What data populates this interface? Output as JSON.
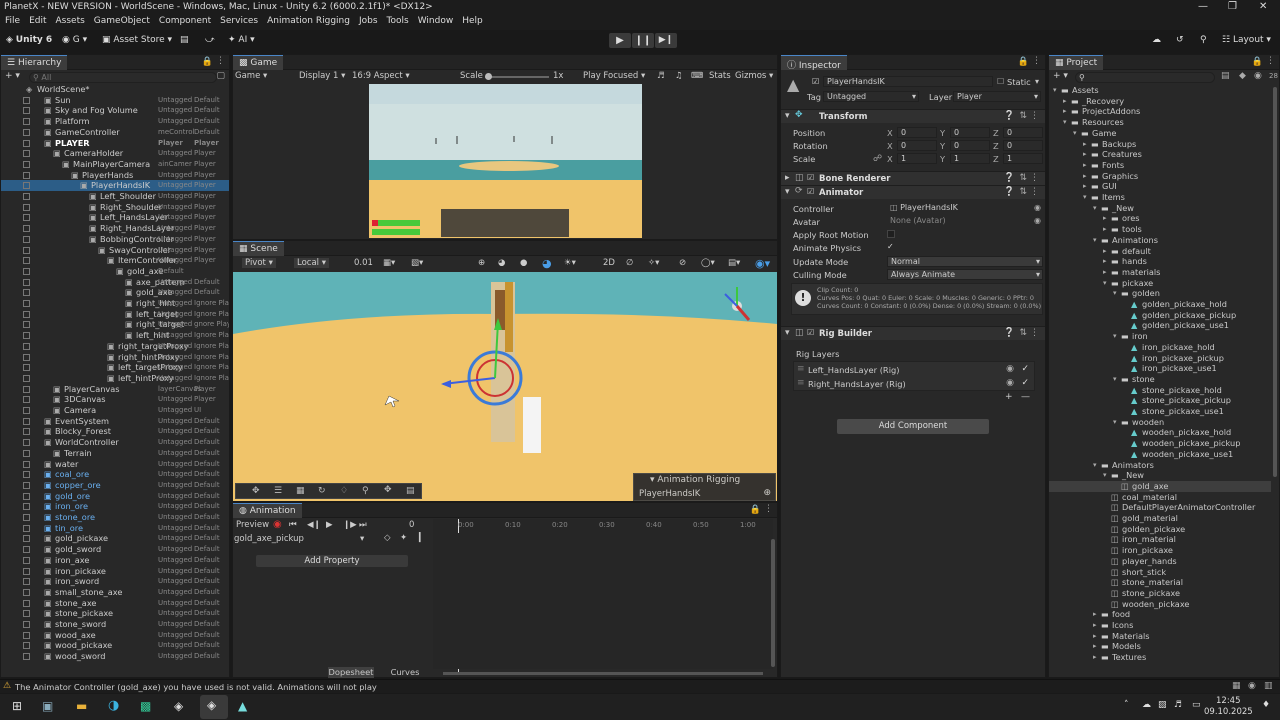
{
  "window": {
    "title": "PlanetX - NEW VERSION - WorldScene - Windows, Mac, Linux - Unity 6.2 (6000.2.1f1)* <DX12>"
  },
  "menu": [
    "File",
    "Edit",
    "Assets",
    "GameObject",
    "Component",
    "Services",
    "Animation Rigging",
    "Jobs",
    "Tools",
    "Window",
    "Help"
  ],
  "toolbar": {
    "unity": "Unity 6",
    "account": "G",
    "asset_store": "Asset Store",
    "ai": "AI",
    "layout": "Layout"
  },
  "hierarchy": {
    "tab": "Hierarchy",
    "search_placeholder": "All",
    "rows": [
      {
        "name": "WorldScene*",
        "indent": 0,
        "tag": "",
        "layer": "",
        "scene": true
      },
      {
        "name": "Sun",
        "indent": 2,
        "tag": "Untagged",
        "layer": "Default"
      },
      {
        "name": "Sky and Fog Volume",
        "indent": 2,
        "tag": "Untagged",
        "layer": "Default"
      },
      {
        "name": "Platform",
        "indent": 2,
        "tag": "Untagged",
        "layer": "Default"
      },
      {
        "name": "GameController",
        "indent": 2,
        "tag": "meControl",
        "layer": "Default"
      },
      {
        "name": "PLAYER",
        "indent": 2,
        "tag": "Player",
        "layer": "Player",
        "bold": true
      },
      {
        "name": "CameraHolder",
        "indent": 3,
        "tag": "Untagged",
        "layer": "Player"
      },
      {
        "name": "MainPlayerCamera",
        "indent": 4,
        "tag": "ainCamer",
        "layer": "Player"
      },
      {
        "name": "PlayerHands",
        "indent": 5,
        "tag": "Untagged",
        "layer": "Player"
      },
      {
        "name": "PlayerHandsIK",
        "indent": 6,
        "tag": "Untagged",
        "layer": "Player",
        "sel": true
      },
      {
        "name": "Left_Shoulder",
        "indent": 7,
        "tag": "Untagged",
        "layer": "Player"
      },
      {
        "name": "Right_Shoulder",
        "indent": 7,
        "tag": "Untagged",
        "layer": "Player"
      },
      {
        "name": "Left_HandsLayer",
        "indent": 7,
        "tag": "Untagged",
        "layer": "Player"
      },
      {
        "name": "Right_HandsLayer",
        "indent": 7,
        "tag": "Untagged",
        "layer": "Player"
      },
      {
        "name": "BobbingController",
        "indent": 7,
        "tag": "Untagged",
        "layer": "Player"
      },
      {
        "name": "SwayController",
        "indent": 8,
        "tag": "Untagged",
        "layer": "Player"
      },
      {
        "name": "ItemController",
        "indent": 9,
        "tag": "Untagged",
        "layer": "Player"
      },
      {
        "name": "gold_axe",
        "indent": 10,
        "tag": "Default",
        "layer": ""
      },
      {
        "name": "axe_pattern",
        "indent": 11,
        "tag": "Untagged",
        "layer": "Default"
      },
      {
        "name": "gold_axe",
        "indent": 11,
        "tag": "Untagged",
        "layer": "Default"
      },
      {
        "name": "right_hint",
        "indent": 11,
        "tag": "Untagged",
        "layer": "Ignore Playe"
      },
      {
        "name": "left_target",
        "indent": 11,
        "tag": "Untagged",
        "layer": "Ignore Playe"
      },
      {
        "name": "right_target",
        "indent": 11,
        "tag": "Untagged",
        "layer": "gnore Playe"
      },
      {
        "name": "left_hint",
        "indent": 11,
        "tag": "Untagged",
        "layer": "Ignore Playe"
      },
      {
        "name": "right_targetProxy",
        "indent": 9,
        "tag": "Untagged",
        "layer": "Ignore Playe"
      },
      {
        "name": "right_hintProxy",
        "indent": 9,
        "tag": "Untagged",
        "layer": "Ignore Playe"
      },
      {
        "name": "left_targetProxy",
        "indent": 9,
        "tag": "Untagged",
        "layer": "Ignore Playe"
      },
      {
        "name": "left_hintProxy",
        "indent": 9,
        "tag": "Untagged",
        "layer": "Ignore Playe"
      },
      {
        "name": "PlayerCanvas",
        "indent": 3,
        "tag": "layerCanvas",
        "layer": "Player"
      },
      {
        "name": "3DCanvas",
        "indent": 3,
        "tag": "Untagged",
        "layer": "Player"
      },
      {
        "name": "Camera",
        "indent": 3,
        "tag": "Untagged",
        "layer": "UI"
      },
      {
        "name": "EventSystem",
        "indent": 2,
        "tag": "Untagged",
        "layer": "Default"
      },
      {
        "name": "Blocky_Forest",
        "indent": 2,
        "tag": "Untagged",
        "layer": "Default"
      },
      {
        "name": "WorldController",
        "indent": 2,
        "tag": "Untagged",
        "layer": "Default"
      },
      {
        "name": "Terrain",
        "indent": 3,
        "tag": "Untagged",
        "layer": "Default"
      },
      {
        "name": "water",
        "indent": 2,
        "tag": "Untagged",
        "layer": "Default"
      },
      {
        "name": "coal_ore",
        "indent": 2,
        "tag": "Untagged",
        "layer": "Default",
        "blue": true
      },
      {
        "name": "copper_ore",
        "indent": 2,
        "tag": "Untagged",
        "layer": "Default",
        "blue": true
      },
      {
        "name": "gold_ore",
        "indent": 2,
        "tag": "Untagged",
        "layer": "Default",
        "blue": true
      },
      {
        "name": "iron_ore",
        "indent": 2,
        "tag": "Untagged",
        "layer": "Default",
        "blue": true
      },
      {
        "name": "stone_ore",
        "indent": 2,
        "tag": "Untagged",
        "layer": "Default",
        "blue": true
      },
      {
        "name": "tin_ore",
        "indent": 2,
        "tag": "Untagged",
        "layer": "Default",
        "blue": true
      },
      {
        "name": "gold_pickaxe",
        "indent": 2,
        "tag": "Untagged",
        "layer": "Default"
      },
      {
        "name": "gold_sword",
        "indent": 2,
        "tag": "Untagged",
        "layer": "Default"
      },
      {
        "name": "iron_axe",
        "indent": 2,
        "tag": "Untagged",
        "layer": "Default"
      },
      {
        "name": "iron_pickaxe",
        "indent": 2,
        "tag": "Untagged",
        "layer": "Default"
      },
      {
        "name": "iron_sword",
        "indent": 2,
        "tag": "Untagged",
        "layer": "Default"
      },
      {
        "name": "small_stone_axe",
        "indent": 2,
        "tag": "Untagged",
        "layer": "Default"
      },
      {
        "name": "stone_axe",
        "indent": 2,
        "tag": "Untagged",
        "layer": "Default"
      },
      {
        "name": "stone_pickaxe",
        "indent": 2,
        "tag": "Untagged",
        "layer": "Default"
      },
      {
        "name": "stone_sword",
        "indent": 2,
        "tag": "Untagged",
        "layer": "Default"
      },
      {
        "name": "wood_axe",
        "indent": 2,
        "tag": "Untagged",
        "layer": "Default"
      },
      {
        "name": "wood_pickaxe",
        "indent": 2,
        "tag": "Untagged",
        "layer": "Default"
      },
      {
        "name": "wood_sword",
        "indent": 2,
        "tag": "Untagged",
        "layer": "Default"
      }
    ]
  },
  "game": {
    "tab": "Game",
    "mode": "Game",
    "display": "Display 1",
    "aspect": "16:9 Aspect",
    "scale_label": "Scale",
    "scale_value": "1x",
    "play_focused": "Play Focused",
    "stats": "Stats",
    "gizmos": "Gizmos"
  },
  "scene": {
    "tab": "Scene",
    "pivot": "Pivot",
    "local": "Local",
    "snap": "0.01",
    "overlay_title": "Animation Rigging",
    "overlay_item": "PlayerHandsIK"
  },
  "animation": {
    "tab": "Animation",
    "preview": "Preview",
    "frame": "0",
    "clip": "gold_axe_pickup",
    "add_property": "Add Property",
    "ticks": [
      "0:00",
      "0:10",
      "0:20",
      "0:30",
      "0:40",
      "0:50",
      "1:00"
    ],
    "dopesheet": "Dopesheet",
    "curves": "Curves"
  },
  "inspector": {
    "tab": "Inspector",
    "object_name": "PlayerHandsIK",
    "static_label": "Static",
    "tag_label": "Tag",
    "tag_value": "Untagged",
    "layer_label": "Layer",
    "layer_value": "Player",
    "transform": {
      "title": "Transform",
      "position": "Position",
      "rotation": "Rotation",
      "scale": "Scale",
      "px": "0",
      "py": "0",
      "pz": "0",
      "rx": "0",
      "ry": "0",
      "rz": "0",
      "sx": "1",
      "sy": "1",
      "sz": "1"
    },
    "bone_renderer": "Bone Renderer",
    "animator": {
      "title": "Animator",
      "controller_label": "Controller",
      "controller_value": "PlayerHandsIK",
      "avatar_label": "Avatar",
      "avatar_value": "None (Avatar)",
      "apply_root": "Apply Root Motion",
      "animate_physics": "Animate Physics",
      "update_mode_label": "Update Mode",
      "update_mode_value": "Normal",
      "culling_label": "Culling Mode",
      "culling_value": "Always Animate",
      "info1": "Clip Count: 0",
      "info2": "Curves Pos: 0 Quat: 0 Euler: 0 Scale: 0 Muscles: 0 Generic: 0 PPtr: 0",
      "info3": "Curves Count: 0 Constant: 0 (0.0%) Dense: 0 (0.0%) Stream: 0 (0.0%)"
    },
    "rig_builder": {
      "title": "Rig Builder",
      "layers_label": "Rig Layers",
      "layers": [
        "Left_HandsLayer (Rig)",
        "Right_HandsLayer (Rig)"
      ]
    },
    "add_component": "Add Component"
  },
  "project": {
    "tab": "Project",
    "count": "28",
    "items": [
      {
        "name": "Assets",
        "indent": 0,
        "type": "folder",
        "open": true
      },
      {
        "name": "_Recovery",
        "indent": 1,
        "type": "folder"
      },
      {
        "name": "ProjectAddons",
        "indent": 1,
        "type": "folder"
      },
      {
        "name": "Resources",
        "indent": 1,
        "type": "folder",
        "open": true
      },
      {
        "name": "Game",
        "indent": 2,
        "type": "folder",
        "open": true
      },
      {
        "name": "Backups",
        "indent": 3,
        "type": "folder"
      },
      {
        "name": "Creatures",
        "indent": 3,
        "type": "folder"
      },
      {
        "name": "Fonts",
        "indent": 3,
        "type": "folder"
      },
      {
        "name": "Graphics",
        "indent": 3,
        "type": "folder"
      },
      {
        "name": "GUI",
        "indent": 3,
        "type": "folder"
      },
      {
        "name": "Items",
        "indent": 3,
        "type": "folder",
        "open": true
      },
      {
        "name": "_New",
        "indent": 4,
        "type": "folder",
        "open": true
      },
      {
        "name": "ores",
        "indent": 5,
        "type": "folder"
      },
      {
        "name": "tools",
        "indent": 5,
        "type": "folder"
      },
      {
        "name": "Animations",
        "indent": 4,
        "type": "folder",
        "open": true
      },
      {
        "name": "default",
        "indent": 5,
        "type": "folder"
      },
      {
        "name": "hands",
        "indent": 5,
        "type": "folder"
      },
      {
        "name": "materials",
        "indent": 5,
        "type": "folder"
      },
      {
        "name": "pickaxe",
        "indent": 5,
        "type": "folder",
        "open": true
      },
      {
        "name": "golden",
        "indent": 6,
        "type": "folder",
        "open": true
      },
      {
        "name": "golden_pickaxe_hold",
        "indent": 7,
        "type": "anim"
      },
      {
        "name": "golden_pickaxe_pickup",
        "indent": 7,
        "type": "anim"
      },
      {
        "name": "golden_pickaxe_use1",
        "indent": 7,
        "type": "anim"
      },
      {
        "name": "iron",
        "indent": 6,
        "type": "folder",
        "open": true
      },
      {
        "name": "iron_pickaxe_hold",
        "indent": 7,
        "type": "anim"
      },
      {
        "name": "iron_pickaxe_pickup",
        "indent": 7,
        "type": "anim"
      },
      {
        "name": "iron_pickaxe_use1",
        "indent": 7,
        "type": "anim"
      },
      {
        "name": "stone",
        "indent": 6,
        "type": "folder",
        "open": true
      },
      {
        "name": "stone_pickaxe_hold",
        "indent": 7,
        "type": "anim"
      },
      {
        "name": "stone_pickaxe_pickup",
        "indent": 7,
        "type": "anim"
      },
      {
        "name": "stone_pickaxe_use1",
        "indent": 7,
        "type": "anim"
      },
      {
        "name": "wooden",
        "indent": 6,
        "type": "folder",
        "open": true
      },
      {
        "name": "wooden_pickaxe_hold",
        "indent": 7,
        "type": "anim"
      },
      {
        "name": "wooden_pickaxe_pickup",
        "indent": 7,
        "type": "anim"
      },
      {
        "name": "wooden_pickaxe_use1",
        "indent": 7,
        "type": "anim"
      },
      {
        "name": "Animators",
        "indent": 4,
        "type": "folder",
        "open": true
      },
      {
        "name": "_New",
        "indent": 5,
        "type": "folder",
        "open": true
      },
      {
        "name": "gold_axe",
        "indent": 6,
        "type": "ctrl",
        "sel": true
      },
      {
        "name": "coal_material",
        "indent": 5,
        "type": "ctrl"
      },
      {
        "name": "DefaultPlayerAnimatorController",
        "indent": 5,
        "type": "ctrl"
      },
      {
        "name": "gold_material",
        "indent": 5,
        "type": "ctrl"
      },
      {
        "name": "golden_pickaxe",
        "indent": 5,
        "type": "ctrl"
      },
      {
        "name": "iron_material",
        "indent": 5,
        "type": "ctrl"
      },
      {
        "name": "iron_pickaxe",
        "indent": 5,
        "type": "ctrl"
      },
      {
        "name": "player_hands",
        "indent": 5,
        "type": "ctrl"
      },
      {
        "name": "short_stick",
        "indent": 5,
        "type": "ctrl"
      },
      {
        "name": "stone_material",
        "indent": 5,
        "type": "ctrl"
      },
      {
        "name": "stone_pickaxe",
        "indent": 5,
        "type": "ctrl"
      },
      {
        "name": "wooden_pickaxe",
        "indent": 5,
        "type": "ctrl"
      },
      {
        "name": "food",
        "indent": 4,
        "type": "folder"
      },
      {
        "name": "Icons",
        "indent": 4,
        "type": "folder"
      },
      {
        "name": "Materials",
        "indent": 4,
        "type": "folder"
      },
      {
        "name": "Models",
        "indent": 4,
        "type": "folder"
      },
      {
        "name": "Textures",
        "indent": 4,
        "type": "folder"
      }
    ]
  },
  "status": {
    "message": "The Animator Controller (gold_axe) you have used is not valid. Animations will not play"
  },
  "taskbar": {
    "time": "12:45",
    "date": "09.10.2025"
  },
  "colors": {
    "accent": "#4a86c8",
    "selection": "#2c5d87",
    "warning": "#e8b13a",
    "sand": "#f0c46a",
    "sky": "#5fb3b7"
  }
}
